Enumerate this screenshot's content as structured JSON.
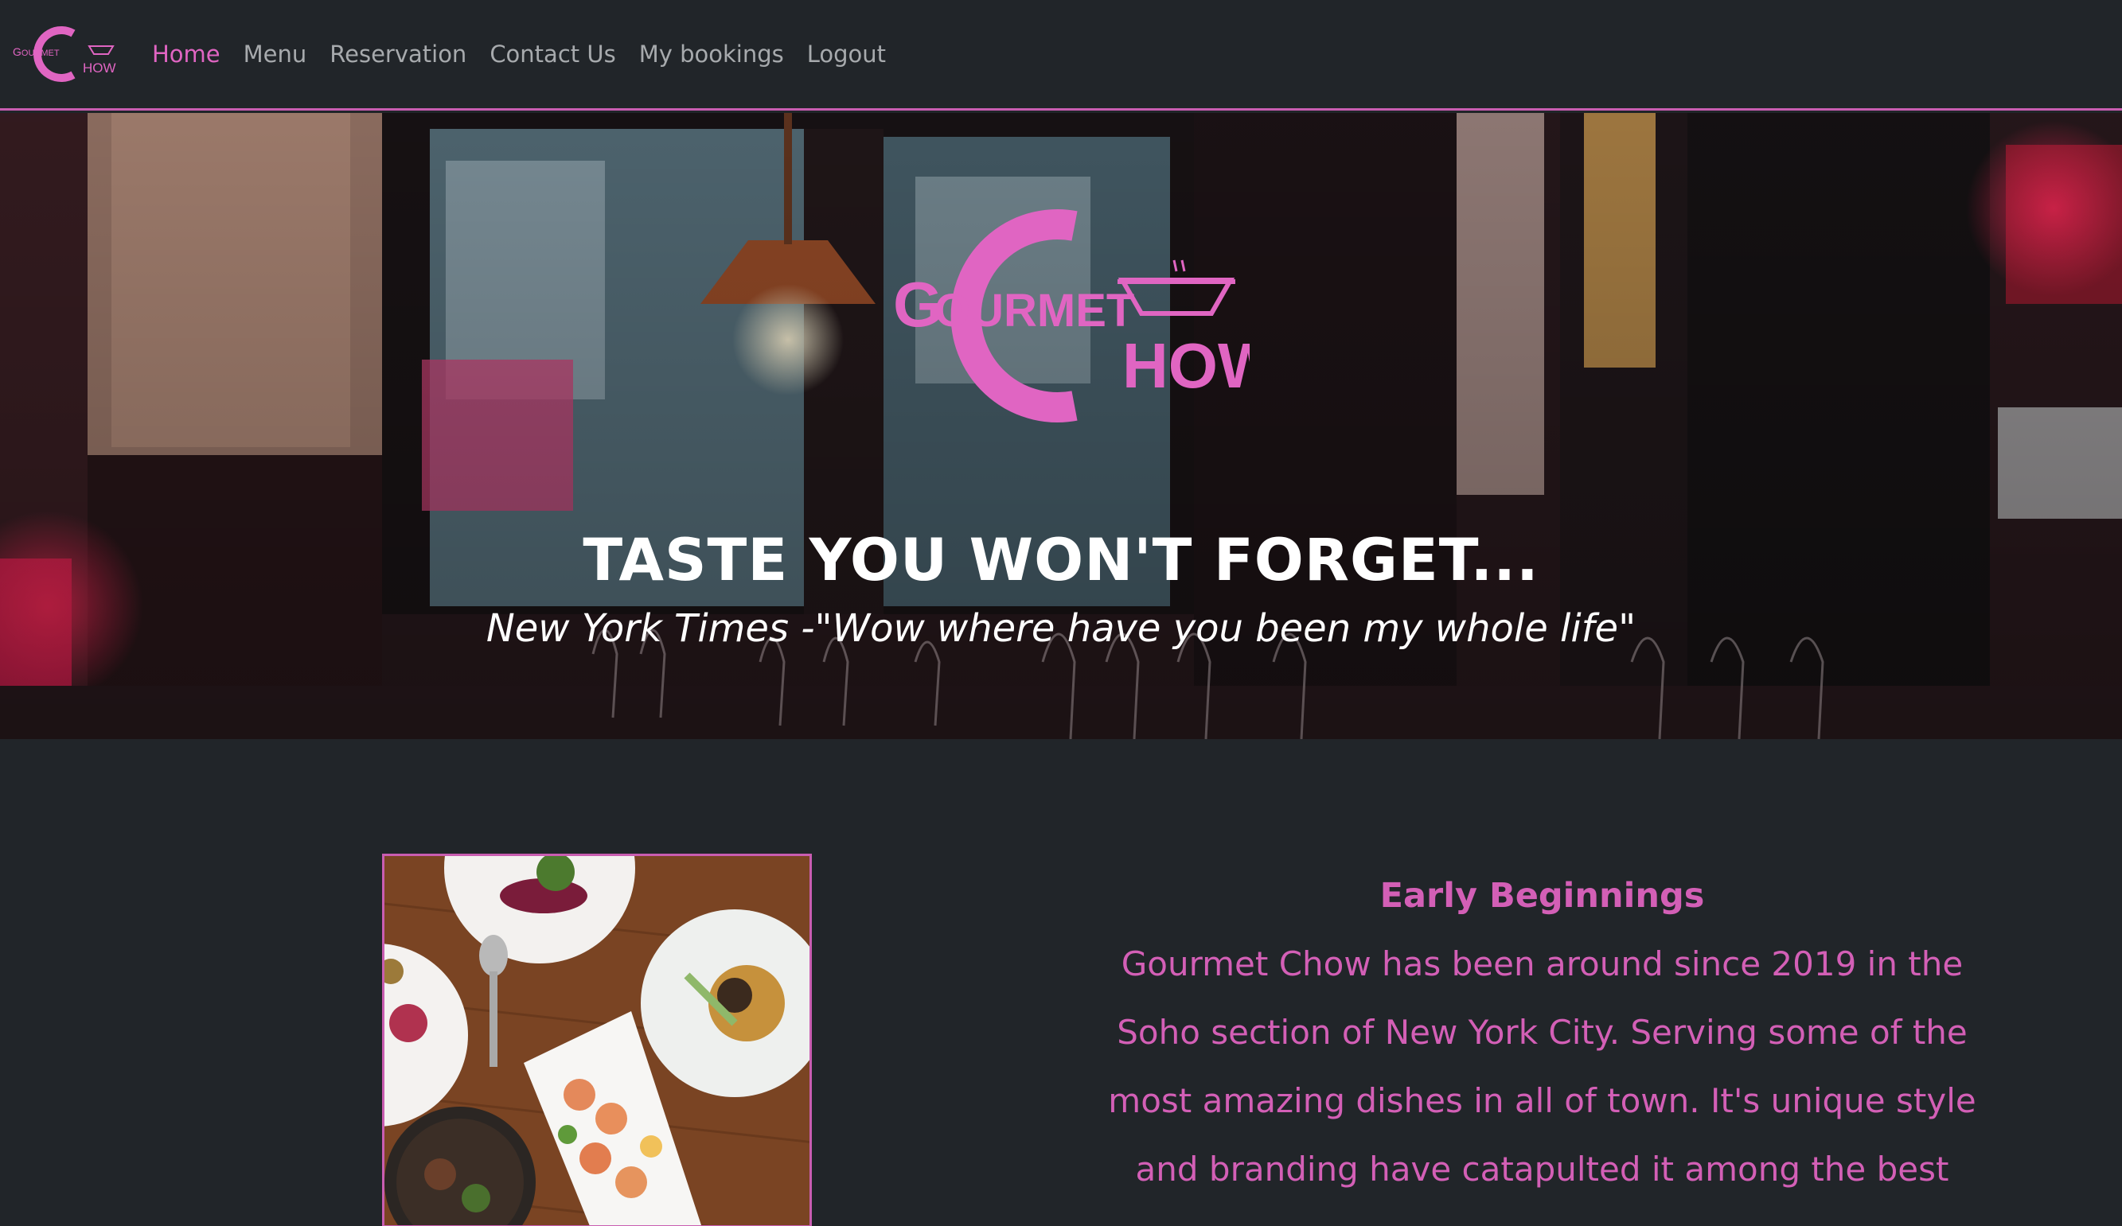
{
  "brand": {
    "logo_text_top": "Gourmet",
    "logo_text_bottom": "How",
    "logo_letter": "C"
  },
  "nav": {
    "items": [
      {
        "label": "Home",
        "active": true
      },
      {
        "label": "Menu",
        "active": false
      },
      {
        "label": "Reservation",
        "active": false
      },
      {
        "label": "Contact Us",
        "active": false
      },
      {
        "label": "My bookings",
        "active": false
      },
      {
        "label": "Logout",
        "active": false
      }
    ]
  },
  "hero": {
    "title": "TASTE YOU WON'T FORGET...",
    "quote": "New York Times -\"Wow where have you been my whole life\""
  },
  "about": {
    "heading": "Early Beginnings",
    "body": "Gourmet Chow has been around since 2019 in the Soho section of New York City. Serving some of the most amazing dishes in all of town. It's unique style and branding have catapulted it among the best"
  },
  "colors": {
    "accent": "#d35fb6",
    "background": "#212529",
    "nav_text": "#a7aaad"
  },
  "icons": {
    "logo": "gourmet-chow-logo",
    "bowl": "bowl-icon"
  }
}
